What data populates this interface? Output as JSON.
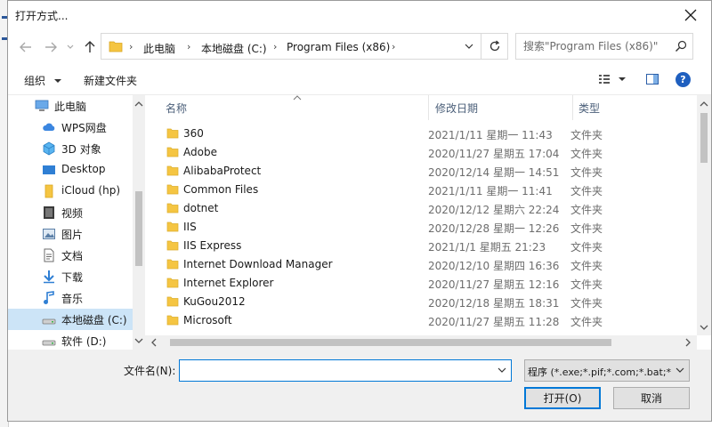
{
  "dialog": {
    "title": "打开方式..."
  },
  "address": {
    "crumbs": [
      "此电脑",
      "本地磁盘 (C:)",
      "Program Files (x86)"
    ]
  },
  "search": {
    "placeholder": "搜索\"Program Files (x86)\""
  },
  "toolbar": {
    "organize_label": "组织",
    "new_folder_label": "新建文件夹"
  },
  "nav": {
    "items": [
      {
        "label": "此电脑",
        "icon": "computer-icon"
      },
      {
        "label": "WPS网盘",
        "icon": "cloud-icon"
      },
      {
        "label": "3D 对象",
        "icon": "cube-icon"
      },
      {
        "label": "Desktop",
        "icon": "desktop-icon"
      },
      {
        "label": "iCloud (hp)",
        "icon": "icloud-icon"
      },
      {
        "label": "视频",
        "icon": "video-icon"
      },
      {
        "label": "图片",
        "icon": "picture-icon"
      },
      {
        "label": "文档",
        "icon": "document-icon"
      },
      {
        "label": "下载",
        "icon": "download-icon"
      },
      {
        "label": "音乐",
        "icon": "music-icon"
      },
      {
        "label": "本地磁盘 (C:)",
        "icon": "drive-icon",
        "selected": true
      },
      {
        "label": "软件 (D:)",
        "icon": "drive-icon"
      }
    ]
  },
  "columns": {
    "name": "名称",
    "date": "修改日期",
    "type": "类型"
  },
  "files": [
    {
      "name": "360",
      "date": "2021/1/11 星期一 11:43",
      "type": "文件夹"
    },
    {
      "name": "Adobe",
      "date": "2020/11/27 星期五 17:04",
      "type": "文件夹"
    },
    {
      "name": "AlibabaProtect",
      "date": "2020/12/14 星期一 14:51",
      "type": "文件夹"
    },
    {
      "name": "Common Files",
      "date": "2021/1/11 星期一 11:41",
      "type": "文件夹"
    },
    {
      "name": "dotnet",
      "date": "2020/12/12 星期六 22:24",
      "type": "文件夹"
    },
    {
      "name": "IIS",
      "date": "2020/12/28 星期一 12:26",
      "type": "文件夹"
    },
    {
      "name": "IIS Express",
      "date": "2021/1/1 星期五 21:23",
      "type": "文件夹"
    },
    {
      "name": "Internet Download Manager",
      "date": "2020/12/10 星期四 16:36",
      "type": "文件夹"
    },
    {
      "name": "Internet Explorer",
      "date": "2020/11/27 星期五 12:16",
      "type": "文件夹"
    },
    {
      "name": "KuGou2012",
      "date": "2020/12/18 星期五 18:31",
      "type": "文件夹"
    },
    {
      "name": "Microsoft",
      "date": "2020/11/27 星期五 11:28",
      "type": "文件夹"
    }
  ],
  "bottom": {
    "filename_label": "文件名(N):",
    "filename_value": "",
    "filter_label": "程序 (*.exe;*.pif;*.com;*.bat;*.",
    "open_label": "打开(O)",
    "cancel_label": "取消"
  },
  "colors": {
    "accent": "#0078d7",
    "selection": "#cce4f7",
    "folder": "#f5c542"
  }
}
